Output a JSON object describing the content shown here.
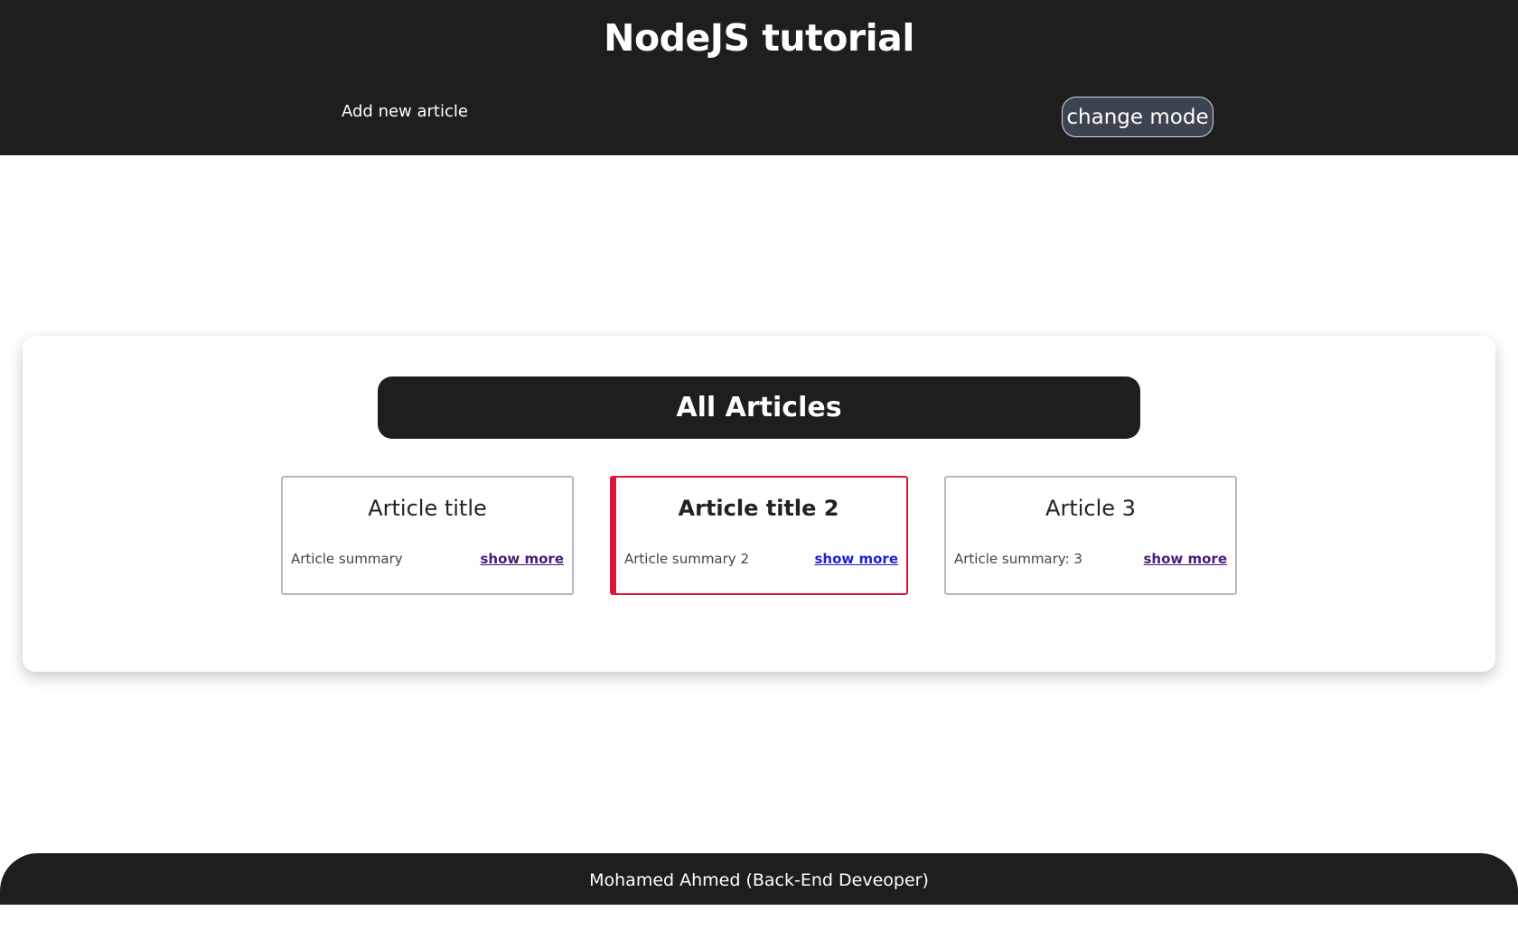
{
  "header": {
    "title": "NodeJS tutorial",
    "nav_link": "Add new article",
    "mode_button": "change mode"
  },
  "main": {
    "heading": "All Articles",
    "articles": [
      {
        "title": "Article title",
        "summary": "Article summary",
        "link": "show more"
      },
      {
        "title": "Article title 2",
        "summary": "Article summary 2",
        "link": "show more"
      },
      {
        "title": "Article 3",
        "summary": "Article summary: 3",
        "link": "show more"
      }
    ]
  },
  "footer": {
    "text": "Mohamed Ahmed (Back-End Deveoper)"
  },
  "colors": {
    "header_bg": "#1e1e1e",
    "button_bg": "#3d4451",
    "active_card_accent": "#dc143c",
    "visited_link": "#4b1a7a",
    "link": "#1f1fd6"
  }
}
